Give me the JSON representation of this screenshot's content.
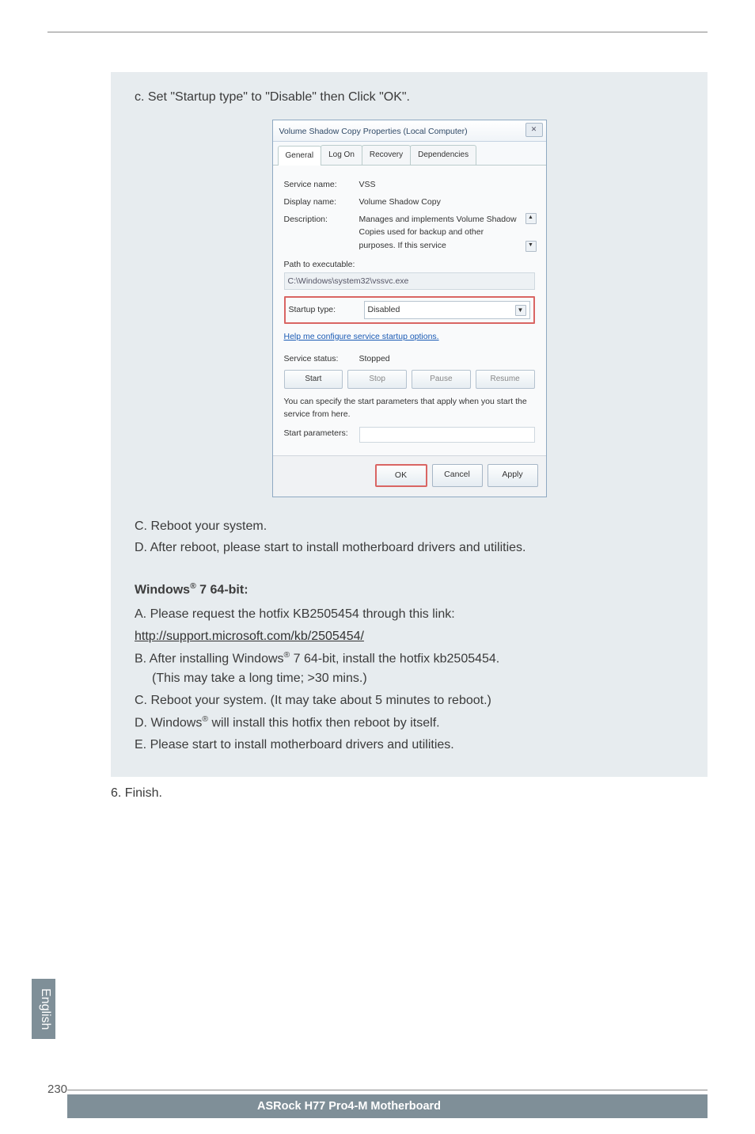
{
  "instruction_c_screenshot": "c. Set \"Startup type\" to \"Disable\" then Click \"OK\".",
  "dialog": {
    "title": "Volume Shadow Copy Properties (Local Computer)",
    "close_glyph": "✕",
    "tabs": {
      "general": "General",
      "logon": "Log On",
      "recovery": "Recovery",
      "dependencies": "Dependencies"
    },
    "labels": {
      "service_name": "Service name:",
      "display_name": "Display name:",
      "description": "Description:",
      "path_label": "Path to executable:",
      "startup_type": "Startup type:",
      "service_status": "Service status:",
      "start_parameters": "Start parameters:"
    },
    "values": {
      "service_name": "VSS",
      "display_name": "Volume Shadow Copy",
      "description": "Manages and implements Volume Shadow Copies used for backup and other purposes. If this service",
      "path": "C:\\Windows\\system32\\vssvc.exe",
      "startup_selected": "Disabled",
      "help_link": "Help me configure service startup options.",
      "service_status": "Stopped",
      "specify_note": "You can specify the start parameters that apply when you start the service from here."
    },
    "buttons": {
      "start": "Start",
      "stop": "Stop",
      "pause": "Pause",
      "resume": "Resume",
      "ok": "OK",
      "cancel": "Cancel",
      "apply": "Apply"
    },
    "arrows": {
      "up": "▲",
      "down": "▼"
    }
  },
  "post_steps": {
    "c_reboot": "C. Reboot your system.",
    "d_after": "D. After reboot, please start to install motherboard drivers and utilities."
  },
  "win7_section": {
    "heading_prefix": "Windows",
    "heading_reg": "®",
    "heading_suffix": " 7 64-bit:",
    "a_text": "A. Please request the hotfix KB2505454 through this link:",
    "a_link": "http://support.microsoft.com/kb/2505454/",
    "b_prefix": "B. After installing Windows",
    "b_suffix": " 7 64-bit, install the hotfix kb2505454.",
    "b_note": "(This may take a long time; >30 mins.)",
    "c_reboot2": "C. Reboot your system. (It may take about 5 minutes to reboot.)",
    "d_prefix": "D. Windows",
    "d_suffix": " will install this hotfix then reboot by itself.",
    "e_text": "E. Please start to install motherboard drivers and utilities."
  },
  "step6": "6. Finish.",
  "side_tab": "English",
  "page_number": "230",
  "footer": "ASRock  H77 Pro4-M  Motherboard"
}
